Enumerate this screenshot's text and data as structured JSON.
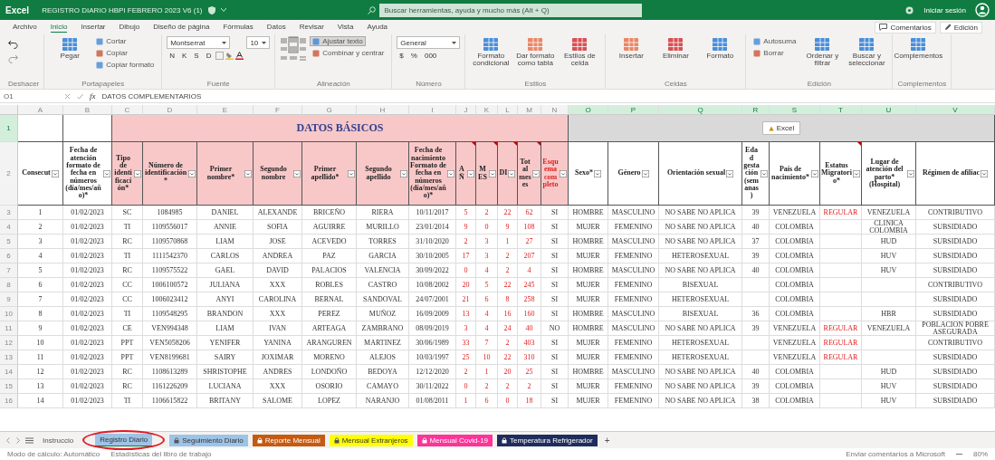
{
  "title_bar": {
    "app": "Excel",
    "file_title": "REGISTRO DIARIO HBPI FEBRERO 2023 V6 (1)",
    "search_placeholder": "Buscar herramientas, ayuda y mucho más (Alt + Q)",
    "sign_in": "Iniciar sesión"
  },
  "ribbon": {
    "tabs": [
      {
        "label": "Archivo",
        "selected": false
      },
      {
        "label": "Inicio",
        "selected": true
      },
      {
        "label": "Insertar",
        "selected": false
      },
      {
        "label": "Dibujo",
        "selected": false
      },
      {
        "label": "Diseño de página",
        "selected": false
      },
      {
        "label": "Fórmulas",
        "selected": false
      },
      {
        "label": "Datos",
        "selected": false
      },
      {
        "label": "Revisar",
        "selected": false
      },
      {
        "label": "Vista",
        "selected": false
      },
      {
        "label": "Ayuda",
        "selected": false
      }
    ],
    "actions": [
      "Comentarios",
      "Edición"
    ],
    "groups": [
      {
        "label": "Deshacer",
        "columns": [
          [
            {
              "kind": "undo"
            },
            {
              "kind": "redo"
            }
          ]
        ]
      },
      {
        "label": "Portapapeles",
        "columns": [
          [
            {
              "kind": "large",
              "label": "Pegar"
            }
          ],
          [
            {
              "kind": "small",
              "label": "Cortar"
            },
            {
              "kind": "small",
              "label": "Copiar"
            },
            {
              "kind": "small",
              "label": "Copiar formato"
            }
          ]
        ]
      },
      {
        "label": "Fuente",
        "columns": [
          [
            {
              "kind": "field",
              "value": "Montserrat"
            },
            {
              "kind": "glyphs",
              "labels": [
                "N",
                "K",
                "S",
                "D"
              ]
            }
          ],
          [
            {
              "kind": "field",
              "value": "10"
            }
          ]
        ]
      },
      {
        "label": "Alineación",
        "columns": [
          [
            {
              "kind": "align"
            }
          ],
          [
            {
              "kind": "small",
              "label": "Ajustar texto",
              "pressed": true
            },
            {
              "kind": "small",
              "label": "Combinar y centrar",
              "pressed": false
            }
          ]
        ]
      },
      {
        "label": "Número",
        "columns": [
          [
            {
              "kind": "field",
              "value": "General"
            },
            {
              "kind": "glyphs",
              "labels": [
                "$",
                "%",
                "000"
              ]
            }
          ]
        ]
      },
      {
        "label": "Estilos",
        "columns": [
          [
            {
              "kind": "large",
              "label": "Formato condicional"
            }
          ],
          [
            {
              "kind": "large",
              "label": "Dar formato como tabla"
            }
          ],
          [
            {
              "kind": "large",
              "label": "Estilos de celda"
            }
          ]
        ]
      },
      {
        "label": "Celdas",
        "columns": [
          [
            {
              "kind": "large",
              "label": "Insertar"
            }
          ],
          [
            {
              "kind": "large",
              "label": "Eliminar"
            }
          ],
          [
            {
              "kind": "large",
              "label": "Formato"
            }
          ]
        ]
      },
      {
        "label": "Edición",
        "columns": [
          [
            {
              "kind": "small",
              "label": "Autosuma"
            },
            {
              "kind": "small",
              "label": "Borrar"
            }
          ],
          [
            {
              "kind": "large",
              "label": "Ordenar y filtrar"
            }
          ],
          [
            {
              "kind": "large",
              "label": "Buscar y seleccionar"
            }
          ]
        ]
      },
      {
        "label": "Complementos",
        "columns": [
          [
            {
              "kind": "large",
              "label": "Complementos"
            }
          ]
        ]
      }
    ]
  },
  "formula_bar": {
    "name_box": "O1",
    "function_label": "fx",
    "value": "DATOS COMPLEMENTARIOS"
  },
  "grid": {
    "column_letters": [
      {
        "label": "A",
        "selected": false
      },
      {
        "label": "B",
        "selected": false
      },
      {
        "label": "C",
        "selected": false
      },
      {
        "label": "D",
        "selected": false
      },
      {
        "label": "E",
        "selected": false
      },
      {
        "label": "F",
        "selected": false
      },
      {
        "label": "G",
        "selected": false
      },
      {
        "label": "H",
        "selected": false
      },
      {
        "label": "I",
        "selected": false
      },
      {
        "label": "J",
        "selected": false
      },
      {
        "label": "K",
        "selected": false
      },
      {
        "label": "L",
        "selected": false
      },
      {
        "label": "M",
        "selected": false
      },
      {
        "label": "N",
        "selected": false
      },
      {
        "label": "O",
        "selected": true
      },
      {
        "label": "P",
        "selected": true
      },
      {
        "label": "Q",
        "selected": true
      },
      {
        "label": "R",
        "selected": true
      },
      {
        "label": "S",
        "selected": true
      },
      {
        "label": "T",
        "selected": true
      },
      {
        "label": "U",
        "selected": true
      },
      {
        "label": "V",
        "selected": true
      }
    ],
    "section_row": {
      "number": "1",
      "selected": true
    },
    "header_row": {
      "number": "2",
      "selected": false
    },
    "sections": [
      {
        "kind": "blank",
        "columns": [
          {
            "header": "Consecut",
            "kind": "data"
          },
          {
            "header": "Fecha de atención formato de fecha en números (día/mes/año)*",
            "kind": "data"
          }
        ]
      },
      {
        "kind": "basic",
        "title": "DATOS BÁSICOS",
        "columns": [
          {
            "header": "Tipo de identificación*",
            "kind": "data"
          },
          {
            "header": "Número de identificación*",
            "kind": "data"
          },
          {
            "header": "Primer nombre*",
            "kind": "data"
          },
          {
            "header": "Segundo nombre",
            "kind": "data"
          },
          {
            "header": "Primer apellido*",
            "kind": "data"
          },
          {
            "header": "Segundo apellido",
            "kind": "data"
          },
          {
            "header": "Fecha de nacimiento Formato de fecha en números (día/mes/año)*",
            "kind": "data"
          },
          {
            "header": "AÑ",
            "kind": "computed"
          },
          {
            "header": "MES",
            "kind": "computed"
          },
          {
            "header": "DI",
            "kind": "computed"
          },
          {
            "header": "Total meses",
            "kind": "computed"
          },
          {
            "header": "Esquema completo",
            "kind": "alert"
          }
        ]
      },
      {
        "kind": "complementary",
        "note": "Excel",
        "columns": [
          {
            "header": "Sexo*",
            "kind": "data"
          },
          {
            "header": "Género",
            "kind": "data"
          },
          {
            "header": "Orientación sexual",
            "kind": "data"
          },
          {
            "header": "Edad gestación (semanas)",
            "kind": "data"
          },
          {
            "header": "País de nacimiento*",
            "kind": "data"
          },
          {
            "header": "Estatus Migratorio*",
            "kind": "computed"
          },
          {
            "header": "Lugar de atención del parto* (Hospital)",
            "kind": "data"
          },
          {
            "header": "Régimen de afiliac",
            "kind": "data"
          }
        ]
      }
    ],
    "rows": [
      {
        "number": "3",
        "cells": [
          "1",
          "01/02/2023",
          "SC",
          "1084985",
          "DANIEL",
          "ALEXANDE",
          "BRICEÑO",
          "RIERA",
          "10/11/2017",
          "5",
          "2",
          "22",
          "62",
          "SI",
          "HOMBRE",
          "MASCULINO",
          "NO SABE NO APLICA",
          "39",
          "VENEZUELA",
          "REGULAR",
          "VENEZUELA",
          "CONTRIBUTIVO"
        ]
      },
      {
        "number": "4",
        "cells": [
          "2",
          "01/02/2023",
          "TI",
          "1109556017",
          "ANNIE",
          "SOFIA",
          "AGUIRRE",
          "MURILLO",
          "23/01/2014",
          "9",
          "0",
          "9",
          "108",
          "SI",
          "MUJER",
          "FEMENINO",
          "NO SABE NO APLICA",
          "40",
          "COLOMBIA",
          "",
          "CLINICA COLOMBIA",
          "SUBSIDIADO"
        ]
      },
      {
        "number": "5",
        "cells": [
          "3",
          "01/02/2023",
          "RC",
          "1109570868",
          "LIAM",
          "JOSE",
          "ACEVEDO",
          "TORRES",
          "31/10/2020",
          "2",
          "3",
          "1",
          "27",
          "SI",
          "HOMBRE",
          "MASCULINO",
          "NO SABE NO APLICA",
          "37",
          "COLOMBIA",
          "",
          "HUD",
          "SUBSIDIADO"
        ]
      },
      {
        "number": "6",
        "cells": [
          "4",
          "01/02/2023",
          "TI",
          "1111542370",
          "CARLOS",
          "ANDREA",
          "PAZ",
          "GARCIA",
          "30/10/2005",
          "17",
          "3",
          "2",
          "207",
          "SI",
          "MUJER",
          "FEMENINO",
          "HETEROSEXUAL",
          "39",
          "COLOMBIA",
          "",
          "HUV",
          "SUBSIDIADO"
        ]
      },
      {
        "number": "7",
        "cells": [
          "5",
          "01/02/2023",
          "RC",
          "1109575522",
          "GAEL",
          "DAVID",
          "PALACIOS",
          "VALENCIA",
          "30/09/2022",
          "0",
          "4",
          "2",
          "4",
          "SI",
          "HOMBRE",
          "MASCULINO",
          "NO SABE NO APLICA",
          "40",
          "COLOMBIA",
          "",
          "HUV",
          "SUBSIDIADO"
        ]
      },
      {
        "number": "8",
        "cells": [
          "6",
          "01/02/2023",
          "CC",
          "1006100572",
          "JULIANA",
          "XXX",
          "ROBLES",
          "CASTRO",
          "10/08/2002",
          "20",
          "5",
          "22",
          "245",
          "SI",
          "MUJER",
          "FEMENINO",
          "BISEXUAL",
          "",
          "COLOMBIA",
          "",
          "",
          "CONTRIBUTIVO"
        ]
      },
      {
        "number": "9",
        "cells": [
          "7",
          "01/02/2023",
          "CC",
          "1006023412",
          "ANYI",
          "CAROLINA",
          "BERNAL",
          "SANDOVAL",
          "24/07/2001",
          "21",
          "6",
          "8",
          "258",
          "SI",
          "MUJER",
          "FEMENINO",
          "HETEROSEXUAL",
          "",
          "COLOMBIA",
          "",
          "",
          "SUBSIDIADO"
        ]
      },
      {
        "number": "10",
        "cells": [
          "8",
          "01/02/2023",
          "TI",
          "1109548295",
          "BRANDON",
          "XXX",
          "PEREZ",
          "MUÑOZ",
          "16/09/2009",
          "13",
          "4",
          "16",
          "160",
          "SI",
          "HOMBRE",
          "MASCULINO",
          "BISEXUAL",
          "36",
          "COLOMBIA",
          "",
          "HBR",
          "SUBSIDIADO"
        ]
      },
      {
        "number": "11",
        "cells": [
          "9",
          "01/02/2023",
          "CE",
          "VEN994348",
          "LIAM",
          "IVAN",
          "ARTEAGA",
          "ZAMBRANO",
          "08/09/2019",
          "3",
          "4",
          "24",
          "40",
          "NO",
          "HOMBRE",
          "MASCULINO",
          "NO SABE NO APLICA",
          "39",
          "VENEZUELA",
          "REGULAR",
          "VENEZUELA",
          "POBLACION POBRE ASEGURADA"
        ]
      },
      {
        "number": "12",
        "cells": [
          "10",
          "01/02/2023",
          "PPT",
          "VEN5058206",
          "YENIFER",
          "YANINA",
          "ARANGUREN",
          "MARTINEZ",
          "30/06/1989",
          "33",
          "7",
          "2",
          "403",
          "SI",
          "MUJER",
          "FEMENINO",
          "HETEROSEXUAL",
          "",
          "VENEZUELA",
          "REGULAR",
          "",
          "CONTRIBUTIVO"
        ]
      },
      {
        "number": "13",
        "cells": [
          "11",
          "01/02/2023",
          "PPT",
          "VEN8199681",
          "SAIRY",
          "JOXIMAR",
          "MORENO",
          "ALEJOS",
          "10/03/1997",
          "25",
          "10",
          "22",
          "310",
          "SI",
          "MUJER",
          "FEMENINO",
          "HETEROSEXUAL",
          "",
          "VENEZUELA",
          "REGULAR",
          "",
          "SUBSIDIADO"
        ]
      },
      {
        "number": "14",
        "cells": [
          "12",
          "01/02/2023",
          "RC",
          "1108613289",
          "SHRISTOPHE",
          "ANDRES",
          "LONDOÑO",
          "BEDOYA",
          "12/12/2020",
          "2",
          "1",
          "20",
          "25",
          "SI",
          "HOMBRE",
          "MASCULINO",
          "NO SABE NO APLICA",
          "40",
          "COLOMBIA",
          "",
          "HUD",
          "SUBSIDIADO"
        ]
      },
      {
        "number": "15",
        "cells": [
          "13",
          "01/02/2023",
          "RC",
          "1161226209",
          "LUCIANA",
          "XXX",
          "OSORIO",
          "CAMAYO",
          "30/11/2022",
          "0",
          "2",
          "2",
          "2",
          "SI",
          "MUJER",
          "FEMENINO",
          "NO SABE NO APLICA",
          "39",
          "COLOMBIA",
          "",
          "HUV",
          "SUBSIDIADO"
        ]
      },
      {
        "number": "16",
        "cells": [
          "14",
          "01/02/2023",
          "TI",
          "1106615822",
          "BRITANY",
          "SALOME",
          "LOPEZ",
          "NARANJO",
          "01/08/2011",
          "1",
          "6",
          "0",
          "18",
          "SI",
          "MUJER",
          "FEMENINO",
          "NO SABE NO APLICA",
          "38",
          "COLOMBIA",
          "",
          "HUV",
          "SUBSIDIADO"
        ]
      }
    ]
  },
  "sheet_tabs": [
    {
      "label": "Instruccio",
      "selected": false
    },
    {
      "label": "Registro Diario",
      "selected": true,
      "locked": false,
      "color": "#9dc3e6",
      "annotated": true
    },
    {
      "label": "Seguimiento Diario",
      "selected": false,
      "locked": true,
      "color": "#9dc3e6",
      "annotated": false
    },
    {
      "label": "Reporte Mensual",
      "selected": false,
      "locked": true,
      "color": "#c55a11",
      "annotated": false
    },
    {
      "label": "Mensual Extranjeros",
      "selected": false,
      "locked": true,
      "color": "#ffff00",
      "annotated": false
    },
    {
      "label": "Mensual Covid-19",
      "selected": false,
      "locked": true,
      "color": "#ff3399",
      "annotated": false
    },
    {
      "label": "Temperatura Refrigerador",
      "selected": false,
      "locked": true,
      "color": "#1f2d5c",
      "annotated": false
    }
  ],
  "add_sheet": "+",
  "status_bar": {
    "left": [
      "Modo de cálculo: Automático",
      "Estadísticas del libro de trabajo"
    ],
    "feedback": "Enviar comentarios a Microsoft",
    "zoom": "80%"
  }
}
